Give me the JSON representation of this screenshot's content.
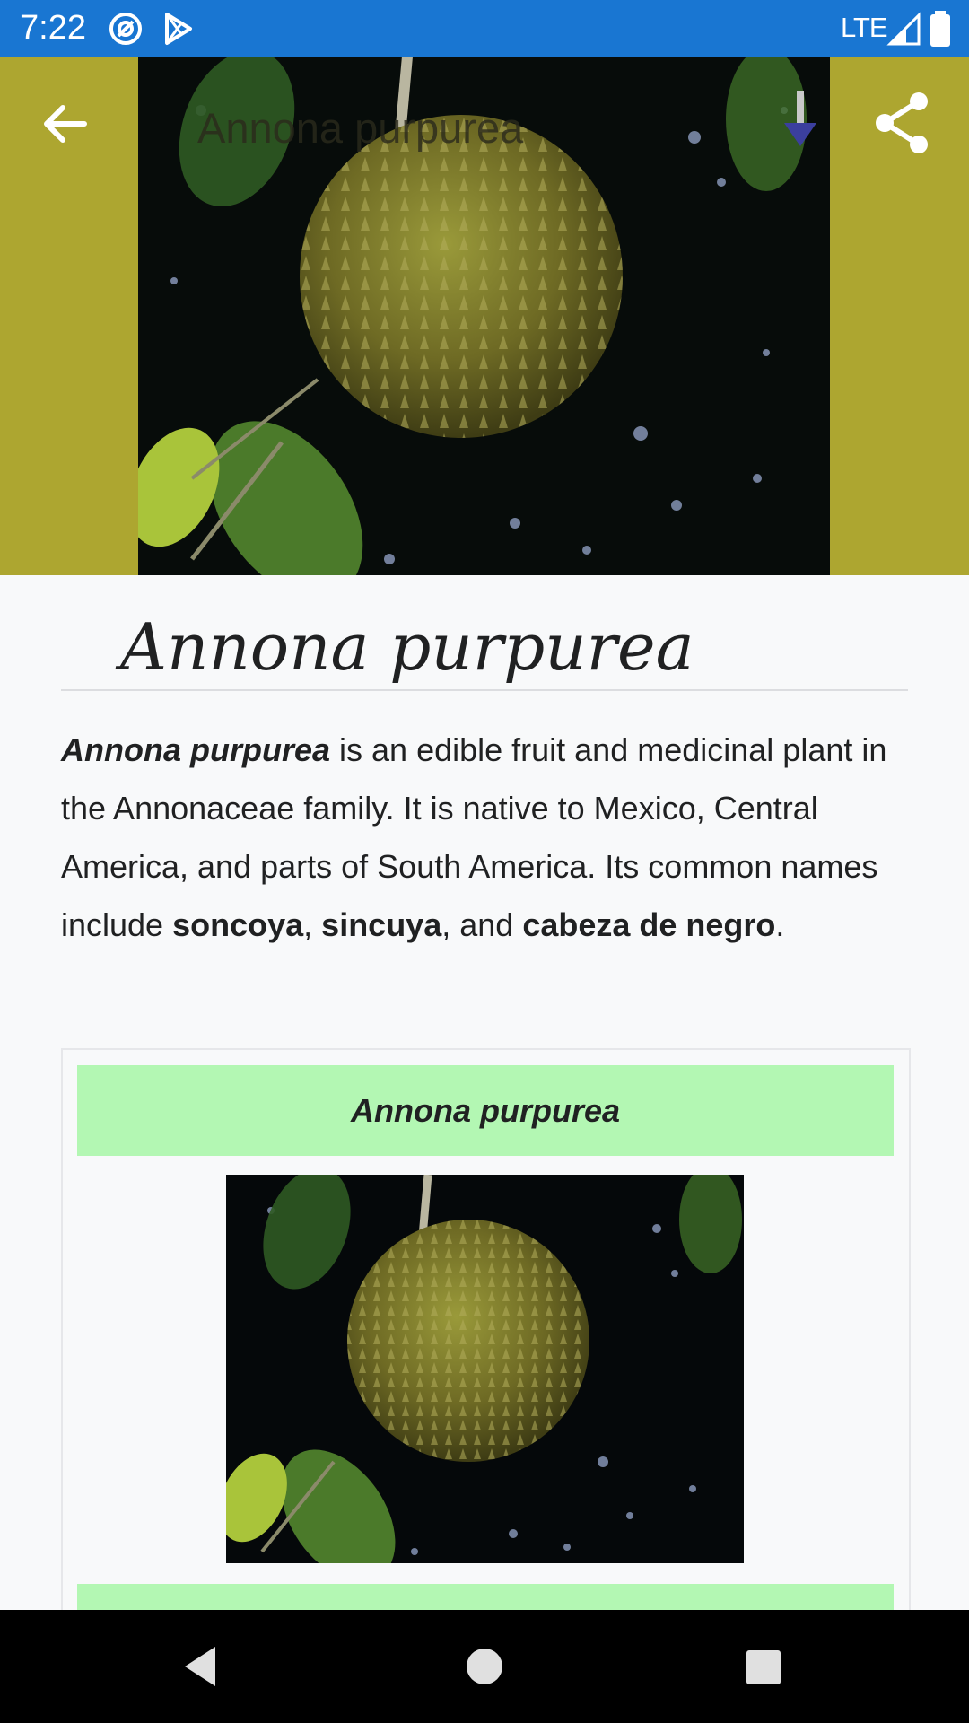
{
  "status_bar": {
    "time": "7:22",
    "network": "LTE",
    "icons": [
      "at-sign-icon",
      "play-store-icon",
      "signal-icon",
      "battery-icon"
    ]
  },
  "header": {
    "title": "Annona purpurea",
    "back_icon": "arrow-left-icon",
    "download_icon": "download-icon",
    "share_icon": "share-icon",
    "accent_color": "#ada630"
  },
  "article": {
    "title": "Annona purpurea",
    "lead": {
      "subject": "Annona purpurea",
      "text_1": " is an edible fruit and medicinal plant in the Annonaceae family. It is native to Mexico, Central America, and parts of South America. Its common names include ",
      "name_1": "soncoya",
      "sep_1": ", ",
      "name_2": "sincuya",
      "sep_2": ", and ",
      "name_3": "cabeza de negro",
      "end": "."
    },
    "infobox": {
      "title": "Annona purpurea",
      "header_color": "#b3f7b3"
    }
  },
  "nav_bar": {
    "back": "triangle-back-icon",
    "home": "circle-home-icon",
    "recents": "square-recents-icon"
  }
}
